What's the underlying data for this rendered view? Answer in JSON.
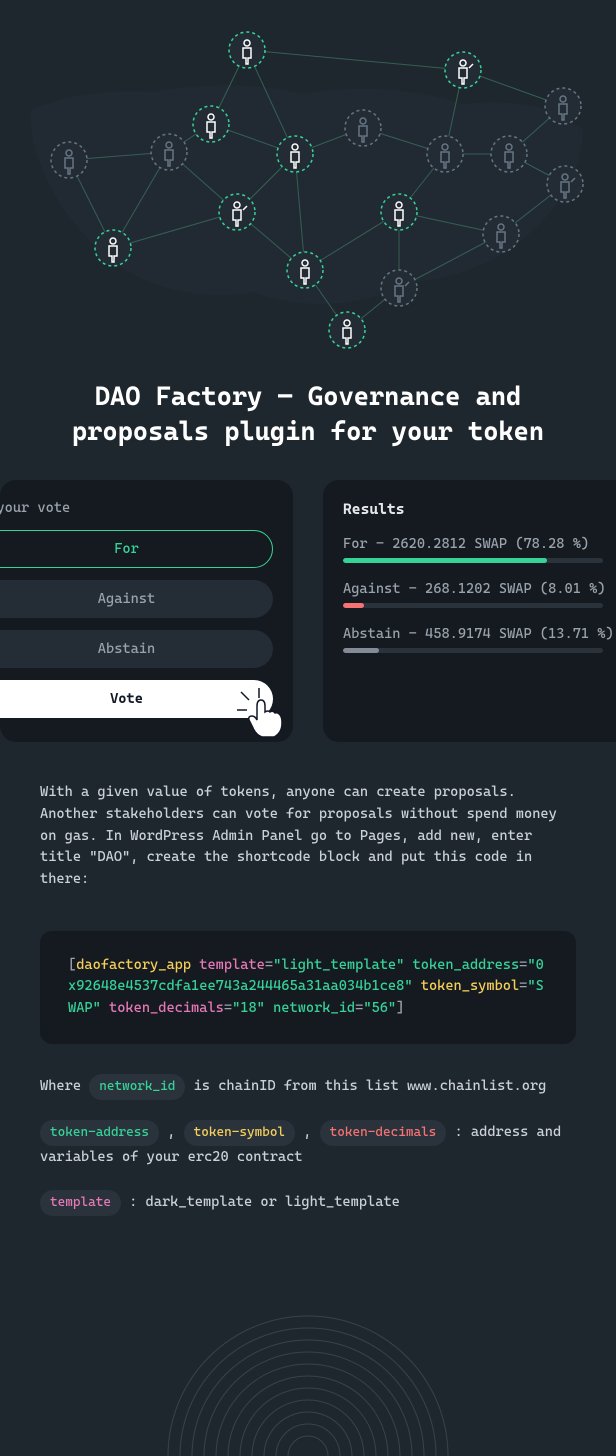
{
  "title": "DAO Factory — Governance and proposals plugin for your token",
  "vote_card": {
    "label": "t your vote",
    "options": {
      "for": "For",
      "against": "Against",
      "abstain": "Abstain"
    },
    "button": "Vote"
  },
  "results_card": {
    "title": "Results",
    "for": {
      "label": "For - 2620.2812 SWAP (78.28 %)",
      "pct": 78.28
    },
    "against": {
      "label": "Against - 268.1202 SWAP (8.01 %)",
      "pct": 8.01
    },
    "abstain": {
      "label": "Abstain - 458.9174 SWAP (13.71 %)",
      "pct": 13.71
    }
  },
  "description": "With a given value of tokens, anyone can create proposals. Another stakeholders can vote for proposals without spend money on gas. In WordPress Admin Panel go to Pages, add new, enter title \"DAO\", create the shortcode block and put this code in there:",
  "code": {
    "tag": "daofactory_app",
    "attrs": {
      "template_k": "template",
      "template_v": "\"light_template\"",
      "token_address_k": "token_address",
      "token_address_v": "\"0x92648e4537cdfa1ee743a244465a31aa034b1ce8\"",
      "token_symbol_k": "token_symbol",
      "token_symbol_v": "\"SWAP\"",
      "token_decimals_k": "token_decimals",
      "token_decimals_v": "\"18\"",
      "network_id_k": "network_id",
      "network_id_v": "\"56\""
    },
    "open": "[",
    "close": "]",
    "eq": "="
  },
  "where": {
    "pre": "Where ",
    "network_id": "network_id",
    "post": " is chainID from this list www.chainlist.org"
  },
  "address_line": {
    "token_address": "token-address",
    "token_symbol": "token-symbol",
    "token_decimals": "token-decimals",
    "comma": " , ",
    "tail": " : address and variables of your erc20 contract"
  },
  "template_line": {
    "template": "template",
    "tail": " : dark_template or light_template"
  }
}
